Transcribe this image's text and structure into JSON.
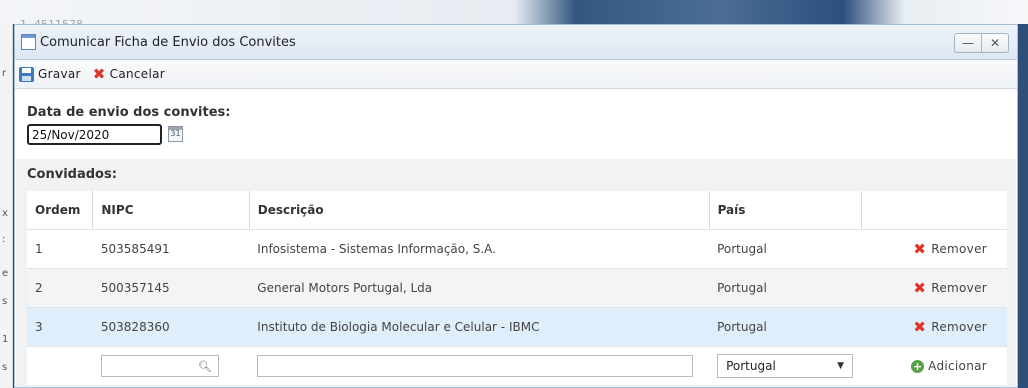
{
  "background": {
    "fragments": [
      "r",
      "x",
      ":",
      "e",
      "s",
      "1",
      "s"
    ],
    "top_number": "1. 4511578"
  },
  "dialog": {
    "title": "Comunicar Ficha de Envio dos Convites",
    "minimize_glyph": "—",
    "close_glyph": "✕"
  },
  "toolbar": {
    "save_label": "Gravar",
    "cancel_label": "Cancelar"
  },
  "form": {
    "date_label": "Data de envio dos convites:",
    "date_value": "25/Nov/2020",
    "calendar_glyph": "31"
  },
  "guests": {
    "section_label": "Convidados:",
    "columns": [
      "Ordem",
      "NIPC",
      "Descrição",
      "País",
      ""
    ],
    "rows": [
      {
        "ordem": "1",
        "nipc": "503585491",
        "descricao": "Infosistema - Sistemas Informação, S.A.",
        "pais": "Portugal",
        "action": "Remover"
      },
      {
        "ordem": "2",
        "nipc": "500357145",
        "descricao": "General Motors Portugal, Lda",
        "pais": "Portugal",
        "action": "Remover"
      },
      {
        "ordem": "3",
        "nipc": "503828360",
        "descricao": "Instituto de Biologia Molecular e Celular - IBMC",
        "pais": "Portugal",
        "action": "Remover"
      }
    ],
    "add_row": {
      "nipc_search_value": "",
      "description_value": "",
      "country_selected": "Portugal",
      "add_label": "Adicionar"
    }
  },
  "colors": {
    "accent_blue": "#3c78c3",
    "remove_red": "#e03428",
    "add_green": "#5aa04a",
    "selected_row": "#dfeefb"
  }
}
